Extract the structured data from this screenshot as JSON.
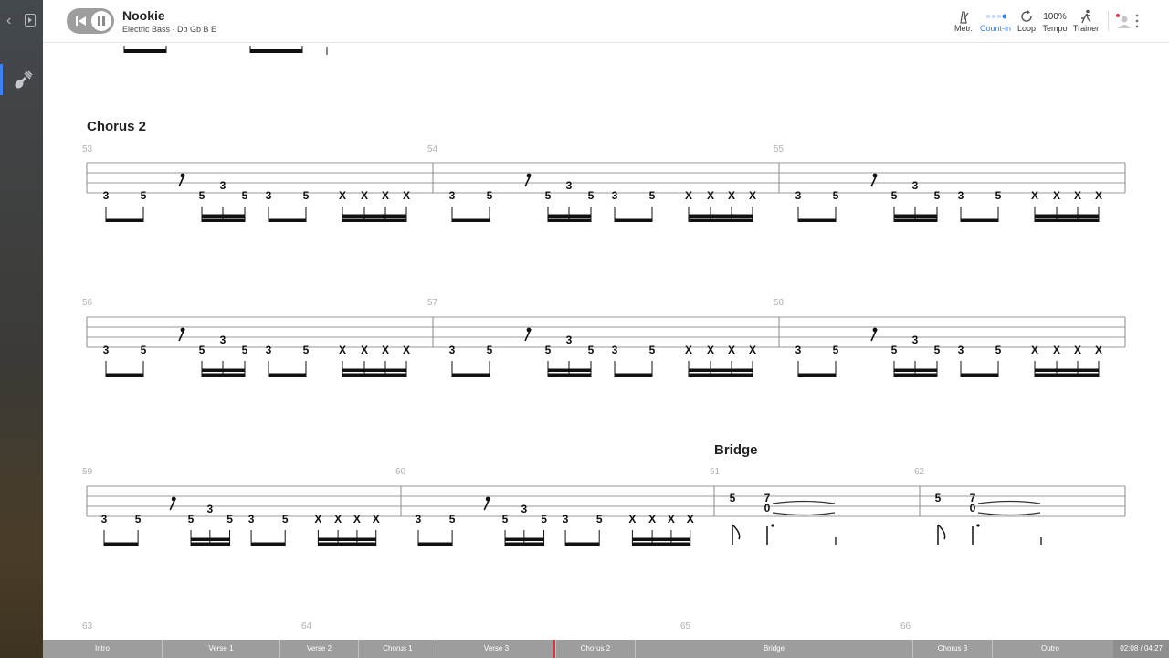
{
  "song": {
    "title": "Nookie",
    "instrument": "Electric Bass",
    "tuning": "Db Gb B E"
  },
  "toolbar": [
    {
      "name": "metronome",
      "label": "Metr.",
      "icon": "metronome-icon",
      "active": false
    },
    {
      "name": "count-in",
      "label": "Count-in",
      "icon": "count-in-dots-icon",
      "active": true
    },
    {
      "name": "loop",
      "label": "Loop",
      "icon": "loop-icon",
      "active": false
    },
    {
      "name": "tempo",
      "label": "Tempo",
      "value": "100%",
      "active": false
    },
    {
      "name": "trainer",
      "label": "Trainer",
      "icon": "runner-icon",
      "active": false
    }
  ],
  "sections": {
    "chorus2": "Chorus 2",
    "bridge": "Bridge"
  },
  "bars": {
    "b53": "53",
    "b54": "54",
    "b55": "55",
    "b56": "56",
    "b57": "57",
    "b58": "58",
    "b59": "59",
    "b60": "60",
    "b61": "61",
    "b62": "62",
    "b63": "63",
    "b64": "64",
    "b65": "65",
    "b66": "66"
  },
  "riff": [
    "3",
    "5",
    "5",
    "3",
    "5",
    "3",
    "5",
    "X",
    "X",
    "X",
    "X"
  ],
  "bridge_notes": {
    "a": "5",
    "b": "7",
    "c": "0"
  },
  "timeline": [
    {
      "label": "Intro"
    },
    {
      "label": "Verse 1"
    },
    {
      "label": "Verse 2"
    },
    {
      "label": "Chorus 1"
    },
    {
      "label": "Verse 3"
    },
    {
      "label": "Chorus 2"
    },
    {
      "label": "Bridge"
    },
    {
      "label": "Chorus 3"
    },
    {
      "label": "Outro"
    }
  ],
  "time": "02:08 / 04:27",
  "colors": {
    "accent": "#3b82f6",
    "cursor": "#e0303a",
    "timeline": "#9d9d9d"
  }
}
